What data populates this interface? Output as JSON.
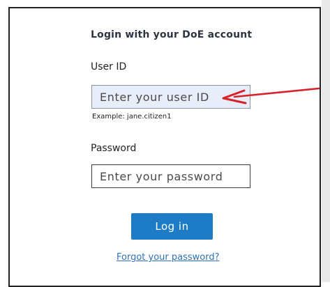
{
  "login": {
    "title": "Login with your DoE account",
    "userid_label": "User ID",
    "userid_placeholder": "Enter your user ID",
    "userid_example": "Example: jane.citizen1",
    "password_label": "Password",
    "password_placeholder": "Enter your password",
    "login_button": "Log in",
    "forgot_link": "Forgot your password?"
  },
  "colors": {
    "button": "#1e7cc6",
    "link": "#2d71b8",
    "focused_input": "#e8eef9",
    "annotation_arrow": "#d8222a"
  },
  "icons": {
    "annotation": "red-arrow-icon"
  }
}
